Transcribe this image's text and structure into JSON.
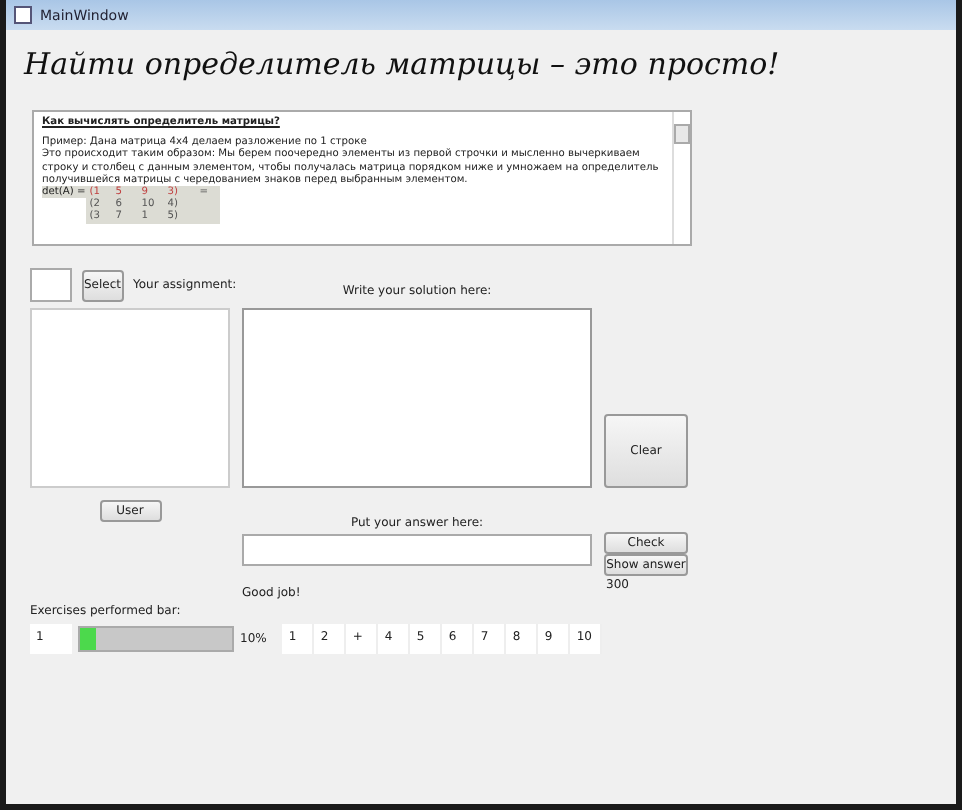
{
  "window": {
    "title": "MainWindow"
  },
  "heading": "Найти определитель матрицы – это просто!",
  "theory": {
    "title": "Как вычислять определитель матрицы?",
    "paragraphs": [
      "Пример: Дана матрица 4x4 делаем разложение по 1 строке",
      "Это происходит таким образом: Мы берем поочередно элементы из первой строчки и мысленно вычеркиваем строку и столбец с данным элементом, чтобы получалась матрица порядком ниже и умножаем на определитель получившейся матрицы с чередованием знаков перед выбранным элементом."
    ],
    "matrix_label": "det(A) =",
    "matrix_rows": [
      {
        "highlighted": true,
        "cells": [
          "(1",
          "5",
          "9",
          "3)"
        ],
        "suffix": "="
      },
      {
        "highlighted": false,
        "cells": [
          "(2",
          "6",
          "10",
          "4)"
        ]
      },
      {
        "highlighted": false,
        "cells": [
          "(3",
          "7",
          "1",
          "5)"
        ]
      }
    ]
  },
  "select_button": "Select",
  "assignment_label": "Your assignment:",
  "solution_label": "Write your solution here:",
  "clear_button": "Clear",
  "user_button": "User",
  "answer_label": "Put your answer here:",
  "check_button": "Check",
  "show_answer_button": "Show answer",
  "score": "300",
  "feedback": "Good job!",
  "progress": {
    "label": "Exercises performed bar:",
    "count": "1",
    "level": 0.1,
    "reading": "10%"
  },
  "exercise_cells": [
    "1",
    "2",
    "+",
    "4",
    "5",
    "6",
    "7",
    "8",
    "9",
    "10"
  ]
}
